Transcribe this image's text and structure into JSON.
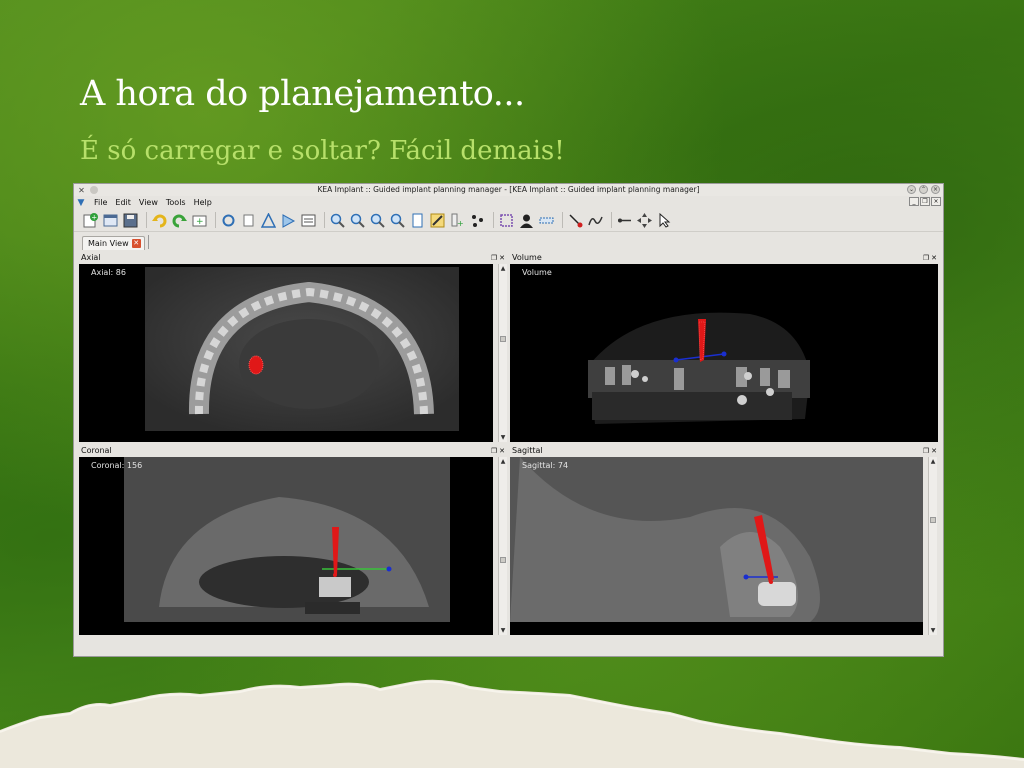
{
  "slide": {
    "title": "A hora do planejamento...",
    "subtitle": "É só carregar e soltar? Fácil demais!"
  },
  "window": {
    "title": "KEA Implant :: Guided implant planning manager - [KEA Implant :: Guided implant planning manager]"
  },
  "menu": [
    "File",
    "Edit",
    "View",
    "Tools",
    "Help"
  ],
  "tabs": [
    "Main View"
  ],
  "panels": {
    "axial": {
      "title": "Axial",
      "label": "Axial: 86"
    },
    "volume": {
      "title": "Volume",
      "label": "Volume"
    },
    "coronal": {
      "title": "Coronal",
      "label": "Coronal: 156"
    },
    "sagittal": {
      "title": "Sagittal",
      "label": "Sagittal: 74"
    }
  },
  "toolbar_icons": [
    "new-icon",
    "open-icon",
    "save-icon",
    "undo-icon",
    "redo-icon",
    "add-icon",
    "rotate-icon",
    "pan-icon",
    "measure-icon",
    "arrow-icon",
    "layout-icon",
    "zoom-in-icon",
    "zoom-out-icon",
    "zoom-fit-icon",
    "zoom-region-icon",
    "page-icon",
    "pencil-icon",
    "add-implant-icon",
    "points-icon",
    "frame-icon",
    "person-icon",
    "ruler-icon",
    "probe-icon",
    "curve-icon",
    "line-icon",
    "move-icon",
    "pointer-icon"
  ],
  "colors": {
    "implant": "#e01818",
    "axis_blue": "#1a2fd0",
    "axis_green": "#39c23a",
    "subtitle": "#b7e06a"
  }
}
